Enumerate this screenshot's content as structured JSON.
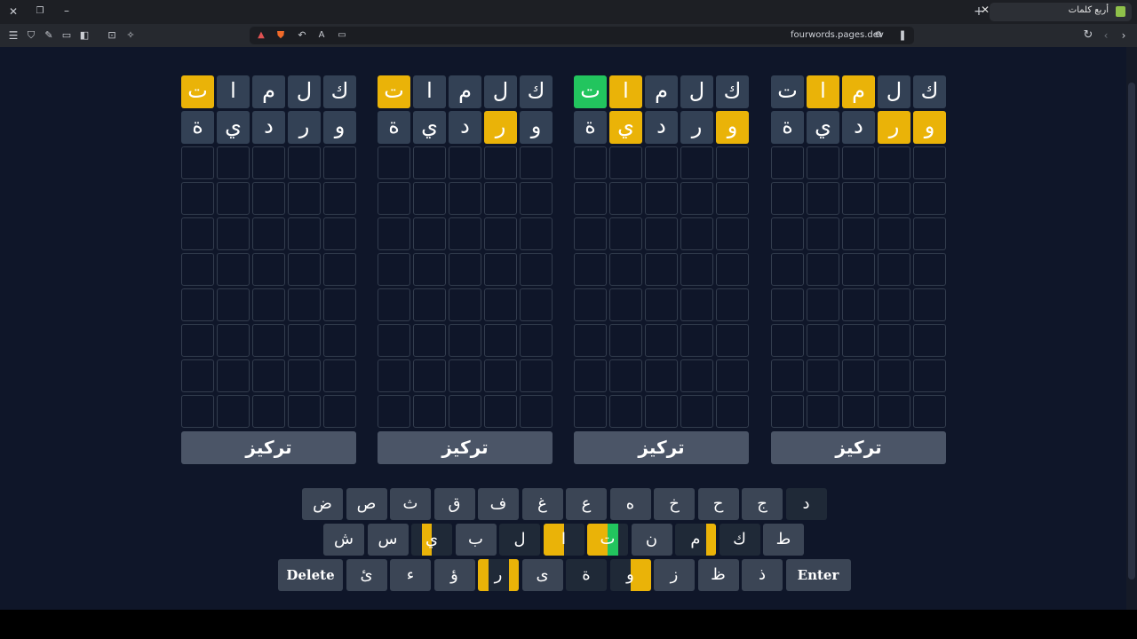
{
  "browser": {
    "tab_title": "أربع كلمات",
    "url": "fourwords.pages.dev"
  },
  "colors": {
    "present": "#eab308",
    "correct": "#22c55e",
    "filled": "#334155",
    "key": "#3b4555",
    "key_dim": "#1f2937"
  },
  "boards": [
    {
      "rows": [
        [
          {
            "l": "ت",
            "s": "present"
          },
          {
            "l": "ا",
            "s": "filled"
          },
          {
            "l": "م",
            "s": "filled"
          },
          {
            "l": "ل",
            "s": "filled"
          },
          {
            "l": "ك",
            "s": "filled"
          }
        ],
        [
          {
            "l": "ة",
            "s": "filled"
          },
          {
            "l": "ي",
            "s": "filled"
          },
          {
            "l": "د",
            "s": "filled"
          },
          {
            "l": "ر",
            "s": "filled"
          },
          {
            "l": "و",
            "s": "filled"
          }
        ]
      ],
      "focus_label": "تركيز"
    },
    {
      "rows": [
        [
          {
            "l": "ت",
            "s": "present"
          },
          {
            "l": "ا",
            "s": "filled"
          },
          {
            "l": "م",
            "s": "filled"
          },
          {
            "l": "ل",
            "s": "filled"
          },
          {
            "l": "ك",
            "s": "filled"
          }
        ],
        [
          {
            "l": "ة",
            "s": "filled"
          },
          {
            "l": "ي",
            "s": "filled"
          },
          {
            "l": "د",
            "s": "filled"
          },
          {
            "l": "ر",
            "s": "present"
          },
          {
            "l": "و",
            "s": "filled"
          }
        ]
      ],
      "focus_label": "تركيز"
    },
    {
      "rows": [
        [
          {
            "l": "ت",
            "s": "correct"
          },
          {
            "l": "ا",
            "s": "present"
          },
          {
            "l": "م",
            "s": "filled"
          },
          {
            "l": "ل",
            "s": "filled"
          },
          {
            "l": "ك",
            "s": "filled"
          }
        ],
        [
          {
            "l": "ة",
            "s": "filled"
          },
          {
            "l": "ي",
            "s": "present"
          },
          {
            "l": "د",
            "s": "filled"
          },
          {
            "l": "ر",
            "s": "filled"
          },
          {
            "l": "و",
            "s": "present"
          }
        ]
      ],
      "focus_label": "تركيز"
    },
    {
      "rows": [
        [
          {
            "l": "ت",
            "s": "filled"
          },
          {
            "l": "ا",
            "s": "present"
          },
          {
            "l": "م",
            "s": "present"
          },
          {
            "l": "ل",
            "s": "filled"
          },
          {
            "l": "ك",
            "s": "filled"
          }
        ],
        [
          {
            "l": "ة",
            "s": "filled"
          },
          {
            "l": "ي",
            "s": "filled"
          },
          {
            "l": "د",
            "s": "filled"
          },
          {
            "l": "ر",
            "s": "present"
          },
          {
            "l": "و",
            "s": "present"
          }
        ]
      ],
      "focus_label": "تركيز"
    }
  ],
  "keyboard": {
    "row1": [
      {
        "l": "ض"
      },
      {
        "l": "ص"
      },
      {
        "l": "ث"
      },
      {
        "l": "ق"
      },
      {
        "l": "ف"
      },
      {
        "l": "غ"
      },
      {
        "l": "ع"
      },
      {
        "l": "ه"
      },
      {
        "l": "خ"
      },
      {
        "l": "ح"
      },
      {
        "l": "ج"
      },
      {
        "l": "د",
        "dim": true
      }
    ],
    "row2": [
      {
        "l": "ش"
      },
      {
        "l": "س"
      },
      {
        "l": "ي",
        "dim": true,
        "q": [
          "",
          "present",
          "",
          ""
        ]
      },
      {
        "l": "ب"
      },
      {
        "l": "ل",
        "dim": true
      },
      {
        "l": "ا",
        "dim": true,
        "q": [
          "present",
          "present",
          "",
          ""
        ]
      },
      {
        "l": "ت",
        "dim": true,
        "q": [
          "present",
          "present",
          "correct",
          ""
        ]
      },
      {
        "l": "ن"
      },
      {
        "l": "م",
        "dim": true,
        "q": [
          "",
          "",
          "",
          "present"
        ]
      },
      {
        "l": "ك",
        "dim": true
      },
      {
        "l": "ط"
      }
    ],
    "row3": [
      {
        "l": "Delete",
        "wide": true
      },
      {
        "l": "ئ"
      },
      {
        "l": "ء"
      },
      {
        "l": "ؤ"
      },
      {
        "l": "ر",
        "dim": true,
        "q": [
          "present",
          "",
          "",
          "present"
        ]
      },
      {
        "l": "ى"
      },
      {
        "l": "ة",
        "dim": true
      },
      {
        "l": "و",
        "dim": true,
        "q": [
          "",
          "",
          "present",
          "present"
        ]
      },
      {
        "l": "ز"
      },
      {
        "l": "ظ"
      },
      {
        "l": "ذ"
      },
      {
        "l": "Enter",
        "wide": true
      }
    ]
  }
}
